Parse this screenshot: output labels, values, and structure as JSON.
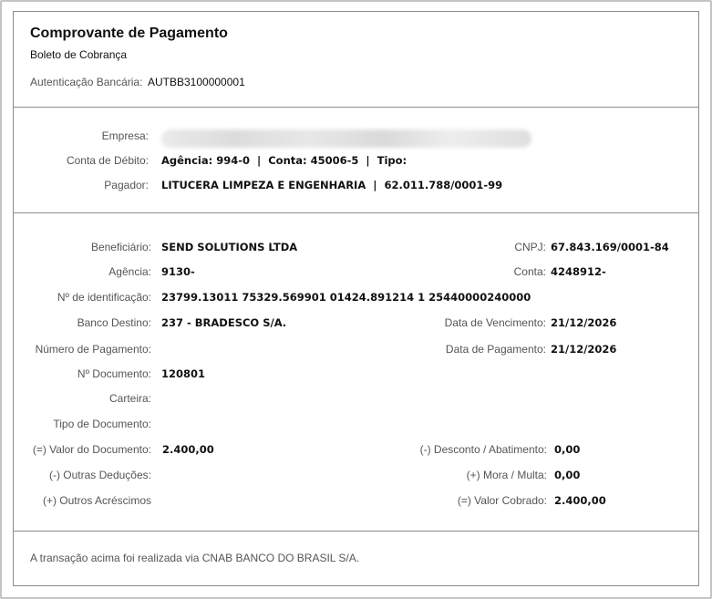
{
  "header": {
    "title": "Comprovante de Pagamento",
    "subtitle": "Boleto de Cobrança",
    "auth_label": "Autenticação Bancária:",
    "auth_value": "AUTBB3100000001"
  },
  "debit": {
    "empresa_label": "Empresa:",
    "conta_label": "Conta de Débito:",
    "conta_value": "Agência: 994-0  |  Conta: 45006-5  |  Tipo:",
    "pagador_label": "Pagador:",
    "pagador_value": "LITUCERA LIMPEZA E ENGENHARIA  |  62.011.788/0001-99"
  },
  "details": {
    "beneficiario_label": "Beneficiário:",
    "beneficiario_value": "SEND SOLUTIONS LTDA",
    "cnpj_label": "CNPJ:",
    "cnpj_value": "67.843.169/0001-84",
    "agencia_label": "Agência:",
    "agencia_value": "9130-",
    "conta_label": "Conta:",
    "conta_value": "4248912-",
    "identificacao_label": "Nº de identificação:",
    "identificacao_value": "23799.13011 75329.569901 01424.891214 1 25440000240000",
    "banco_label": "Banco Destino:",
    "banco_value": "237 - BRADESCO S/A.",
    "vencimento_label": "Data de Vencimento:",
    "vencimento_value": "21/12/2026",
    "numero_pagamento_label": "Número de Pagamento:",
    "data_pagamento_label": "Data de Pagamento:",
    "data_pagamento_value": "21/12/2026",
    "documento_label": "Nº Documento:",
    "documento_value": "120801",
    "carteira_label": "Carteira:",
    "tipo_documento_label": "Tipo de Documento:",
    "valor_documento_label": "(=) Valor do Documento:",
    "valor_documento_value": "2.400,00",
    "desconto_label": "(-) Desconto / Abatimento:",
    "desconto_value": "0,00",
    "outras_deducoes_label": "(-) Outras Deduções:",
    "mora_label": "(+) Mora / Multa:",
    "mora_value": "0,00",
    "outros_acrescimos_label": "(+) Outros Acréscimos",
    "valor_cobrado_label": "(=) Valor Cobrado:",
    "valor_cobrado_value": "2.400,00"
  },
  "footer": {
    "text": "A transação acima foi realizada via CNAB BANCO DO BRASIL S/A."
  }
}
